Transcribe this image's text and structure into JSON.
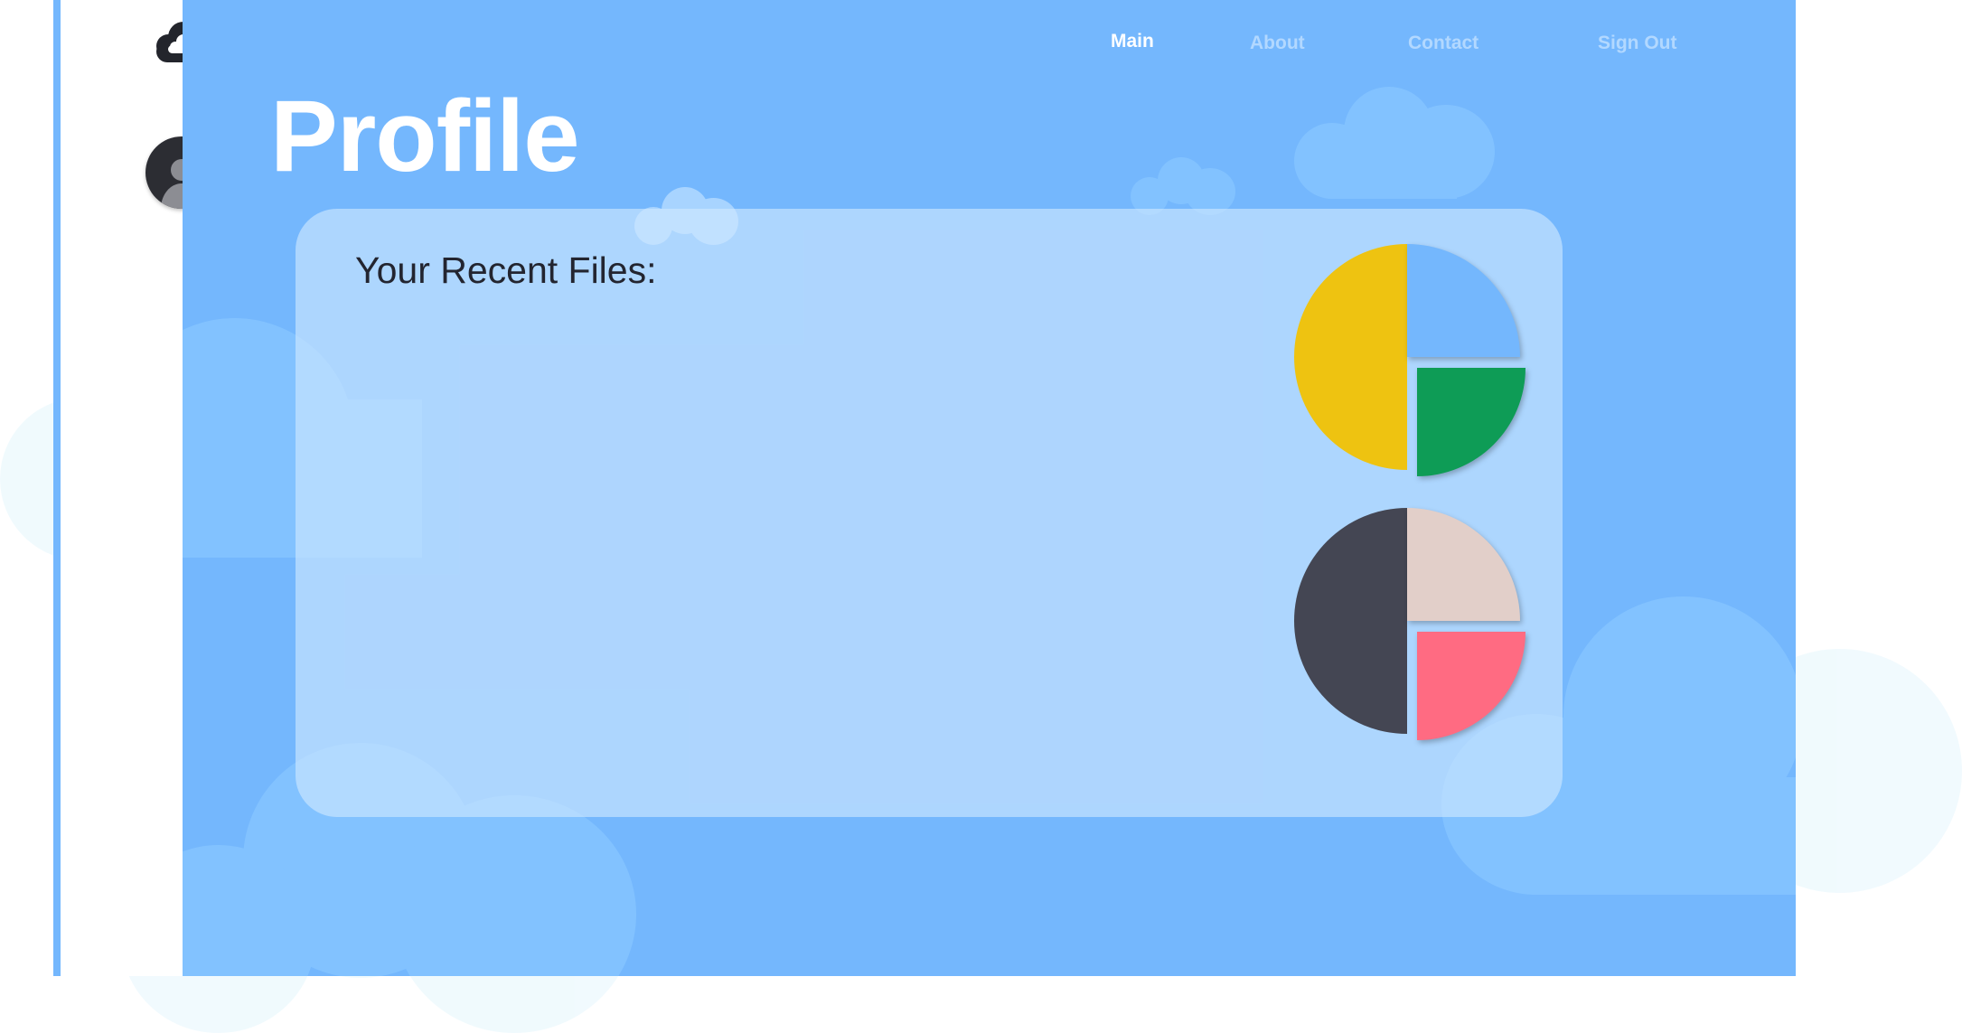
{
  "nav": {
    "items": [
      {
        "label": "Main",
        "active": true
      },
      {
        "label": "About",
        "active": false
      },
      {
        "label": "Contact",
        "active": false
      },
      {
        "label": "Sign Out",
        "active": false
      }
    ]
  },
  "page": {
    "title": "Profile"
  },
  "recent_files": {
    "heading": "Your Recent Files:"
  },
  "colors": {
    "background": "#74b7fd",
    "chart_1": [
      "#eec311",
      "#74b7fd",
      "#0e9c56"
    ],
    "chart_2": [
      "#444653",
      "#e2cfc9",
      "#ff6b82"
    ]
  }
}
